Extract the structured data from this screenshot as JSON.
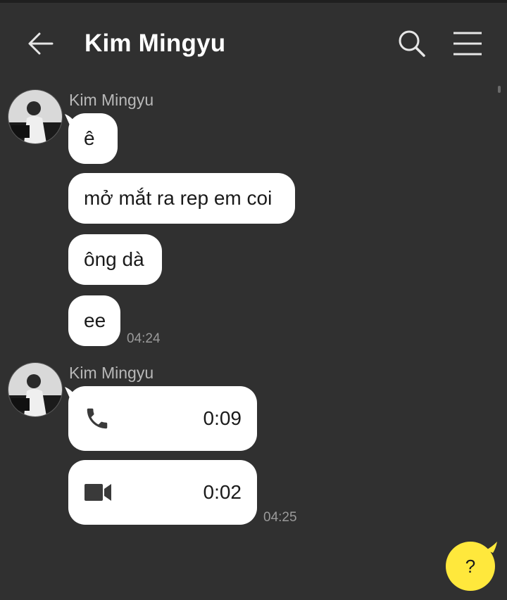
{
  "header": {
    "title": "Kim Mingyu",
    "back_icon": "arrow-left-icon",
    "search_icon": "search-icon",
    "menu_icon": "hamburger-menu-icon"
  },
  "colors": {
    "background": "#303030",
    "bubble": "#ffffff",
    "help_button": "#ffe83c"
  },
  "messages": {
    "group1": {
      "sender": "Kim Mingyu",
      "texts": [
        "ê",
        "mở mắt ra rep em coi",
        "ông dà",
        "ee"
      ],
      "time": "04:24"
    },
    "group2": {
      "sender": "Kim Mingyu",
      "calls": [
        {
          "type": "voice",
          "icon": "phone-icon",
          "duration": "0:09"
        },
        {
          "type": "video",
          "icon": "video-camera-icon",
          "duration": "0:02"
        }
      ],
      "time": "04:25"
    }
  },
  "help": {
    "label": "?"
  }
}
